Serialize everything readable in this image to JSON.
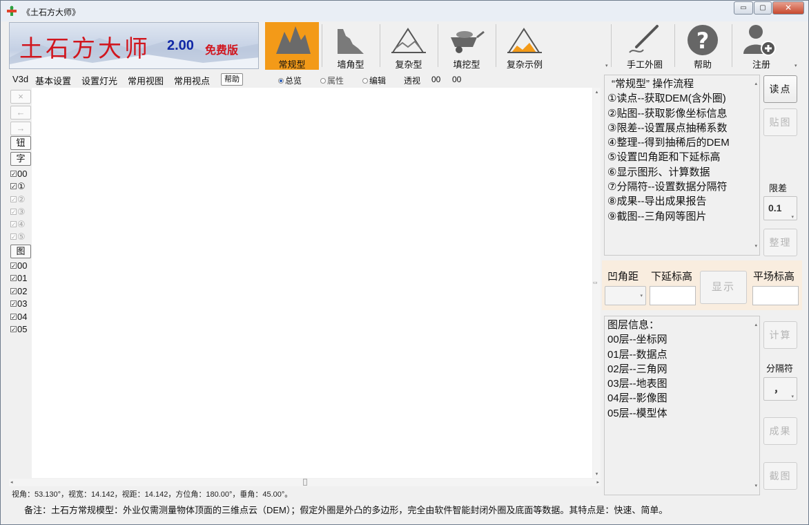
{
  "window": {
    "title": "《土石方大师》",
    "controls": {
      "minimize": "▭",
      "maximize": "▢",
      "close": "✕"
    }
  },
  "banner": {
    "brand": "土石方大师",
    "version": "2.00",
    "edition": "免费版"
  },
  "toolbar": [
    {
      "id": "regular",
      "label": "常规型",
      "icon": "mountain-icon",
      "active": true
    },
    {
      "id": "wall-corner",
      "label": "墙角型",
      "icon": "wall-corner-icon"
    },
    {
      "id": "complex",
      "label": "复杂型",
      "icon": "complex-terrain-icon"
    },
    {
      "id": "fill",
      "label": "填挖型",
      "icon": "wheelbarrow-icon"
    },
    {
      "id": "complex-example",
      "label": "复杂示例",
      "icon": "complex-example-icon"
    }
  ],
  "toolbar_right": [
    {
      "id": "manual-outline",
      "label": "手工外圈",
      "icon": "pen-icon"
    },
    {
      "id": "help",
      "label": "帮助",
      "icon": "question-icon"
    },
    {
      "id": "register",
      "label": "注册",
      "icon": "add-user-icon"
    }
  ],
  "subbar": {
    "v3": "V3d",
    "menus": [
      "基本设置",
      "设置灯光",
      "常用视图",
      "常用视点"
    ],
    "help": "帮助",
    "radios": [
      {
        "label": "总览",
        "checked": true
      },
      {
        "label": "属性",
        "checked": false
      },
      {
        "label": "编辑",
        "checked": false
      }
    ],
    "perspective": "透视",
    "val1": "00",
    "val2": "00"
  },
  "left_tools": {
    "close": "×",
    "back": "←",
    "forward": "→",
    "button": "钮",
    "text": "字",
    "checks_a": [
      {
        "label": "00",
        "enabled": true
      },
      {
        "label": "①",
        "enabled": true
      },
      {
        "label": "②",
        "enabled": false
      },
      {
        "label": "③",
        "enabled": false
      },
      {
        "label": "④",
        "enabled": false
      },
      {
        "label": "⑤",
        "enabled": false
      }
    ],
    "figure": "图",
    "checks_b": [
      "00",
      "01",
      "02",
      "03",
      "04",
      "05"
    ]
  },
  "workflow": {
    "title": "“常规型” 操作流程",
    "steps": [
      "①读点--获取DEM(含外圈)",
      "②贴图--获取影像坐标信息",
      "③限差--设置展点抽稀系数",
      "④整理--得到抽稀后的DEM",
      "⑤设置凹角距和下延标高",
      "⑥显示图形、计算数据",
      "⑦分隔符--设置数据分隔符",
      "⑧成果--导出成果报告",
      "⑨截图--三角网等图片"
    ]
  },
  "right_buttons": {
    "read": "读点",
    "paste": "贴图",
    "tolerance_label": "限差",
    "tolerance_value": "0.1",
    "organize": "整理",
    "show": "显示",
    "calc": "计算",
    "separator_label": "分隔符",
    "separator_value": "，",
    "result": "成果",
    "screenshot": "截图"
  },
  "params": {
    "concave": "凹角距",
    "lower": "下延标高",
    "flat": "平场标高"
  },
  "layers": {
    "title": "图层信息：",
    "items": [
      "00层--坐标网",
      "01层--数据点",
      "02层--三角网",
      "03层--地表图",
      "04层--影像图",
      "05层--模型体"
    ]
  },
  "status": {
    "view": "视角：53.130°，视宽：14.142，视距：14.142，方位角：180.00°，垂角：45.00°。",
    "note": "备注：土石方常规模型：外业仅需测量物体顶面的三维点云（DEM）；假定外圈是外凸的多边形，完全由软件智能封闭外圈及底面等数据。其特点是：快速、简单。"
  }
}
